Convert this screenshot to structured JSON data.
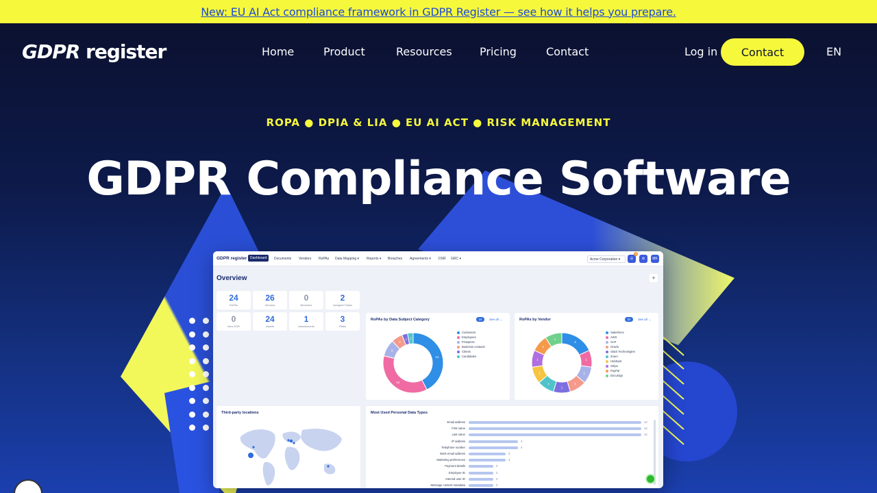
{
  "banner": {
    "text": "New: EU AI Act compliance framework in GDPR Register — see how it helps you prepare."
  },
  "brand": {
    "logo_bold": "GDPR",
    "logo_rest": " register"
  },
  "nav": {
    "items": [
      "Home",
      "Product",
      "Resources",
      "Pricing",
      "Contact"
    ],
    "login": "Log in",
    "cta": "Contact",
    "lang": "EN"
  },
  "hero": {
    "kicker": "ROPA ● DPIA & LIA ● EU AI ACT ● RISK MANAGEMENT",
    "title": "GDPR Compliance Software"
  },
  "colors": {
    "accent_yellow": "#f6f83c",
    "brand_blue": "#2f6bdc",
    "dark_navy": "#0b1130"
  },
  "app": {
    "logo": "GDPR register",
    "nav": [
      "Dashboard",
      "Documents",
      "Vendors",
      "RoPAs",
      "Data Mapping ▾",
      "Reports ▾",
      "Breaches",
      "Agreements ▾",
      "DSR",
      "GRC ▾"
    ],
    "org": "Acme Corporation ▾",
    "notif_count": "3",
    "user_initials": "MK",
    "overview": "Overview",
    "stats": [
      {
        "value": "24",
        "label": "RoPAs"
      },
      {
        "value": "26",
        "label": "Vendors"
      },
      {
        "value": "0",
        "label": "Breaches"
      },
      {
        "value": "2",
        "label": "Assigned Tasks"
      },
      {
        "value": "0",
        "label": "New DSR"
      },
      {
        "value": "24",
        "label": "Assets"
      },
      {
        "value": "1",
        "label": "Assessments"
      },
      {
        "value": "3",
        "label": "Risks"
      }
    ],
    "ropa_category": {
      "title": "RoPAs by Data Subject Category",
      "count": "24",
      "see_all": "See all →",
      "legend": [
        "Customers",
        "Employees",
        "Prospects",
        "Business contacts",
        "Clients",
        "Candidates"
      ],
      "slices": [
        14,
        12,
        3,
        2,
        1,
        1
      ],
      "slice_colors": [
        "#2f8ee6",
        "#f06ba3",
        "#a7b3e8",
        "#f59a8b",
        "#7c6fe0",
        "#4fc3c9"
      ]
    },
    "ropa_vendor": {
      "title": "RoPAs by Vendor",
      "count": "24",
      "see_all": "See all →",
      "legend": [
        "Salesforce",
        "AWS",
        "SAP",
        "Oracle",
        "Slack Technologies",
        "Zoom",
        "HubSpot",
        "Stripe",
        "PayPal",
        "DocuSign"
      ],
      "slices": [
        2,
        1,
        1,
        1,
        1,
        1,
        1,
        1,
        1,
        1
      ],
      "slice_colors": [
        "#2f8ee6",
        "#f06ba3",
        "#a7b3e8",
        "#f59a8b",
        "#7c6fe0",
        "#4fc3c9",
        "#f5c542",
        "#b06fe0",
        "#f59a4b",
        "#6fd18b"
      ]
    },
    "locations": {
      "title": "Third-party locations"
    },
    "data_types": {
      "title": "Most Used Personal Data Types",
      "rows": [
        {
          "label": "Email address",
          "value": 14
        },
        {
          "label": "First name",
          "value": 14
        },
        {
          "label": "Last name",
          "value": 14
        },
        {
          "label": "IP address",
          "value": 4
        },
        {
          "label": "Telephone number",
          "value": 4
        },
        {
          "label": "Work email address",
          "value": 3
        },
        {
          "label": "Marketing preferences",
          "value": 3
        },
        {
          "label": "Payment details",
          "value": 2
        },
        {
          "label": "Employee ID",
          "value": 2
        },
        {
          "label": "Internal user ID",
          "value": 2
        },
        {
          "label": "Message content metadata",
          "value": 2
        }
      ]
    }
  }
}
